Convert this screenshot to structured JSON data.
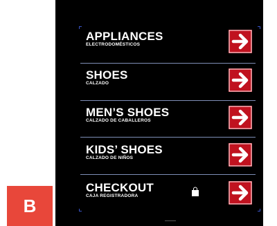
{
  "sign": {
    "rows": [
      {
        "title": "APPLIANCES",
        "subtitle": "ELECTRODOMÉSTICOS"
      },
      {
        "title": "SHOES",
        "subtitle": "CALZADO"
      },
      {
        "title": "MEN’S SHOES",
        "subtitle": "CALZADO DE CABALLEROS"
      },
      {
        "title": "KIDS’ SHOES",
        "subtitle": "CALZADO DE NIÑOS"
      },
      {
        "title": "CHECKOUT",
        "subtitle": "CAJA REGISTRADORA"
      }
    ],
    "arrow_icon": "right-arrow-icon",
    "bag_icon": "shopping-bag-icon"
  },
  "badge": {
    "label": "B"
  },
  "colors": {
    "sign_background": "#000000",
    "arrow_background": "#c0121f",
    "badge_background": "#e8473a",
    "divider": "#7f8fb8"
  }
}
